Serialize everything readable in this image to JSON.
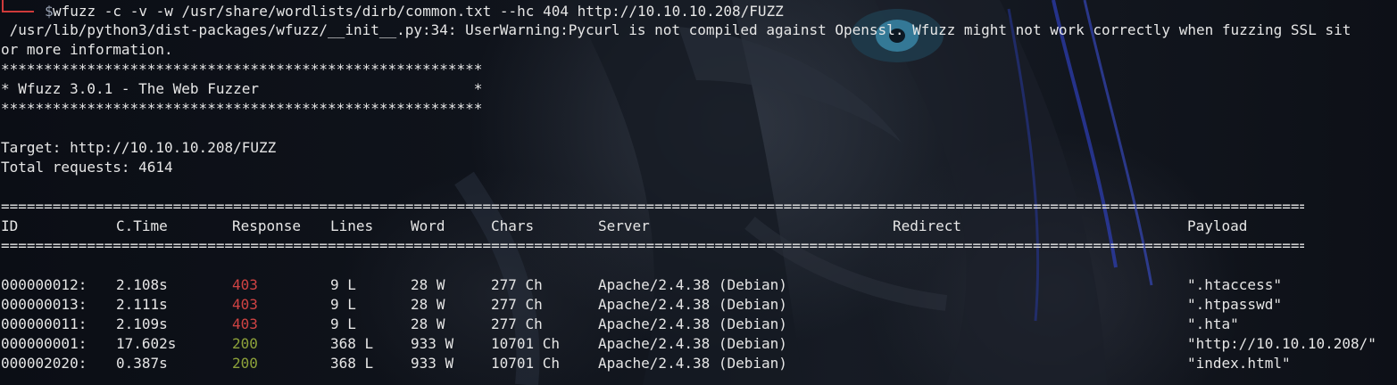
{
  "terminal": {
    "prompt_symbol": "$",
    "command": "wfuzz -c -v -w /usr/share/wordlists/dirb/common.txt --hc 404 http://10.10.10.208/FUZZ",
    "warning_line1": " /usr/lib/python3/dist-packages/wfuzz/__init__.py:34: UserWarning:Pycurl is not compiled against Openssl. Wfuzz might not work correctly when fuzzing SSL sit",
    "warning_line2": "or more information.",
    "banner_border": "********************************************************",
    "banner_title": "* Wfuzz 3.0.1 - The Web Fuzzer                         *",
    "target": "Target: http://10.10.10.208/FUZZ",
    "total_requests": "Total requests: 4614",
    "separator": "=========================================================================================================================================================================",
    "headers": {
      "id": "ID",
      "ctime": "C.Time",
      "response": "Response",
      "lines": "Lines",
      "word": "Word",
      "chars": "Chars",
      "server": "Server",
      "redirect": "Redirect",
      "payload": "Payload"
    },
    "rows": [
      {
        "id": "000000012:",
        "ctime": "2.108s",
        "response": "403",
        "lines": "9 L",
        "word": "28 W",
        "chars": "277 Ch",
        "server": "Apache/2.4.38 (Debian)",
        "redirect": "",
        "payload": "\".htaccess\""
      },
      {
        "id": "000000013:",
        "ctime": "2.111s",
        "response": "403",
        "lines": "9 L",
        "word": "28 W",
        "chars": "277 Ch",
        "server": "Apache/2.4.38 (Debian)",
        "redirect": "",
        "payload": "\".htpasswd\""
      },
      {
        "id": "000000011:",
        "ctime": "2.109s",
        "response": "403",
        "lines": "9 L",
        "word": "28 W",
        "chars": "277 Ch",
        "server": "Apache/2.4.38 (Debian)",
        "redirect": "",
        "payload": "\".hta\""
      },
      {
        "id": "000000001:",
        "ctime": "17.602s",
        "response": "200",
        "lines": "368 L",
        "word": "933 W",
        "chars": "10701 Ch",
        "server": "Apache/2.4.38 (Debian)",
        "redirect": "",
        "payload": "\"http://10.10.10.208/\""
      },
      {
        "id": "000002020:",
        "ctime": "0.387s",
        "response": "200",
        "lines": "368 L",
        "word": "933 W",
        "chars": "10701 Ch",
        "server": "Apache/2.4.38 (Debian)",
        "redirect": "",
        "payload": "\"index.html\""
      }
    ]
  },
  "colors": {
    "text": "#e6e6e6",
    "status_403": "#d04343",
    "status_200": "#8da23a",
    "prompt_corner": "#cf3a3a",
    "background": "#0a0d14"
  }
}
